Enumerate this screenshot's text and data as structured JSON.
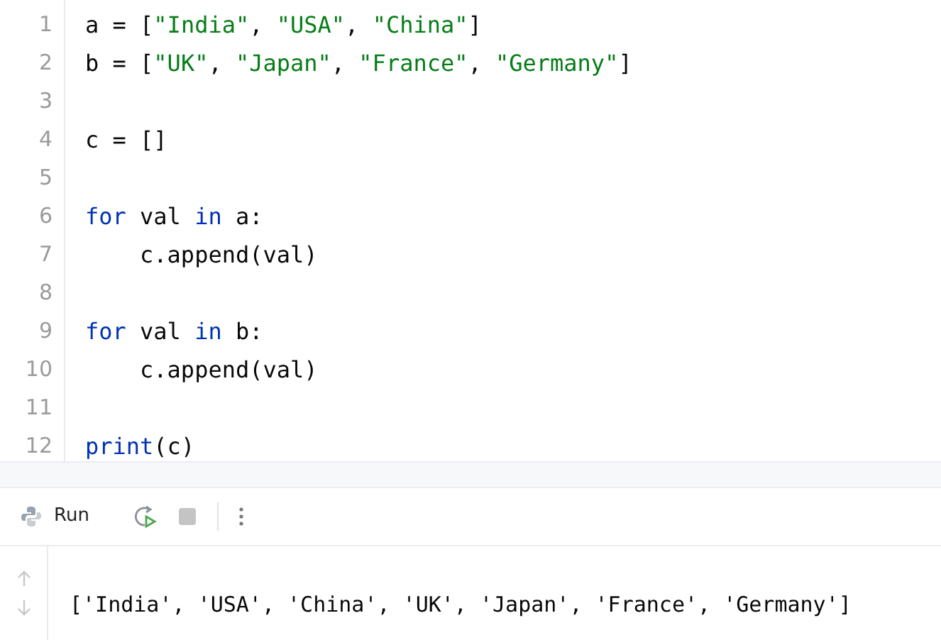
{
  "editor": {
    "lines": [
      {
        "number": "1",
        "tokens": [
          {
            "kind": "plain",
            "text": "a = ["
          },
          {
            "kind": "string",
            "text": "\"India\""
          },
          {
            "kind": "plain",
            "text": ", "
          },
          {
            "kind": "string",
            "text": "\"USA\""
          },
          {
            "kind": "plain",
            "text": ", "
          },
          {
            "kind": "string",
            "text": "\"China\""
          },
          {
            "kind": "plain",
            "text": "]"
          }
        ]
      },
      {
        "number": "2",
        "tokens": [
          {
            "kind": "plain",
            "text": "b = ["
          },
          {
            "kind": "string",
            "text": "\"UK\""
          },
          {
            "kind": "plain",
            "text": ", "
          },
          {
            "kind": "string",
            "text": "\"Japan\""
          },
          {
            "kind": "plain",
            "text": ", "
          },
          {
            "kind": "string",
            "text": "\"France\""
          },
          {
            "kind": "plain",
            "text": ", "
          },
          {
            "kind": "string",
            "text": "\"Germany\""
          },
          {
            "kind": "plain",
            "text": "]"
          }
        ]
      },
      {
        "number": "3"
      },
      {
        "number": "4",
        "tokens": [
          {
            "kind": "plain",
            "text": "c = []"
          }
        ]
      },
      {
        "number": "5"
      },
      {
        "number": "6",
        "tokens": [
          {
            "kind": "keyword",
            "text": "for"
          },
          {
            "kind": "plain",
            "text": " val "
          },
          {
            "kind": "keyword",
            "text": "in"
          },
          {
            "kind": "plain",
            "text": " a:"
          }
        ]
      },
      {
        "number": "7",
        "tokens": [
          {
            "kind": "plain",
            "text": "    c.append(val)"
          }
        ]
      },
      {
        "number": "8"
      },
      {
        "number": "9",
        "tokens": [
          {
            "kind": "keyword",
            "text": "for"
          },
          {
            "kind": "plain",
            "text": " val "
          },
          {
            "kind": "keyword",
            "text": "in"
          },
          {
            "kind": "plain",
            "text": " b:"
          }
        ]
      },
      {
        "number": "10",
        "tokens": [
          {
            "kind": "plain",
            "text": "    c.append(val)"
          }
        ]
      },
      {
        "number": "11"
      },
      {
        "number": "12",
        "tokens": [
          {
            "kind": "keyword",
            "text": "print"
          },
          {
            "kind": "plain",
            "text": "(c)"
          }
        ]
      }
    ]
  },
  "run_panel": {
    "tab_label": "Run",
    "output": "['India', 'USA', 'China', 'UK', 'Japan', 'France', 'Germany']"
  }
}
